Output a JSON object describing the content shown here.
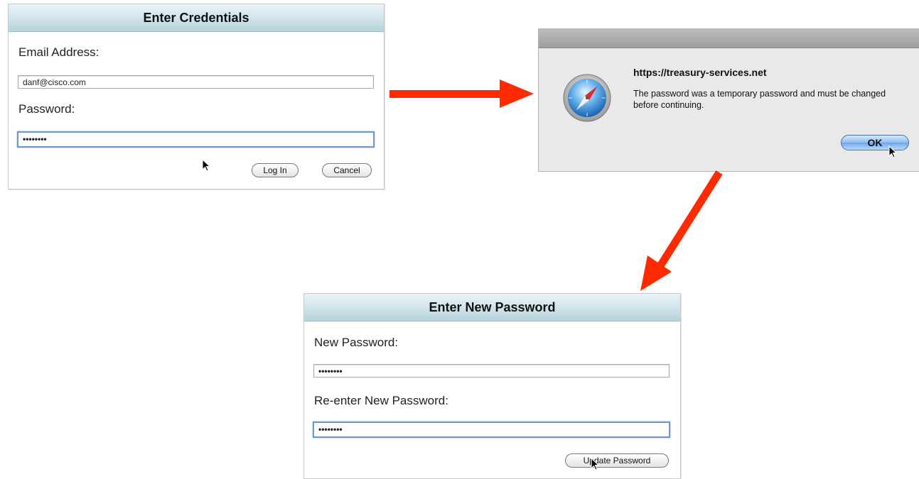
{
  "login_panel": {
    "title": "Enter Credentials",
    "email_label": "Email Address:",
    "email_value": "danf@cisco.com",
    "password_label": "Password:",
    "password_value": "••••••••",
    "login_button": "Log In",
    "cancel_button": "Cancel"
  },
  "alert_dialog": {
    "host": "https://treasury-services.net",
    "message": "The password was a temporary password and must be changed before continuing.",
    "ok_button": "OK",
    "icon": "safari-compass-icon"
  },
  "new_password_panel": {
    "title": "Enter New Password",
    "new_password_label": "New Password:",
    "new_password_value": "••••••••",
    "reenter_label": "Re-enter New Password:",
    "reenter_value": "••••••••",
    "update_button": "Update Password"
  },
  "colors": {
    "arrow": "#ff2a00",
    "header_gradient_top": "#e9f3f6",
    "header_gradient_bottom": "#b7d3dc",
    "focus_ring": "#6f97c9"
  }
}
